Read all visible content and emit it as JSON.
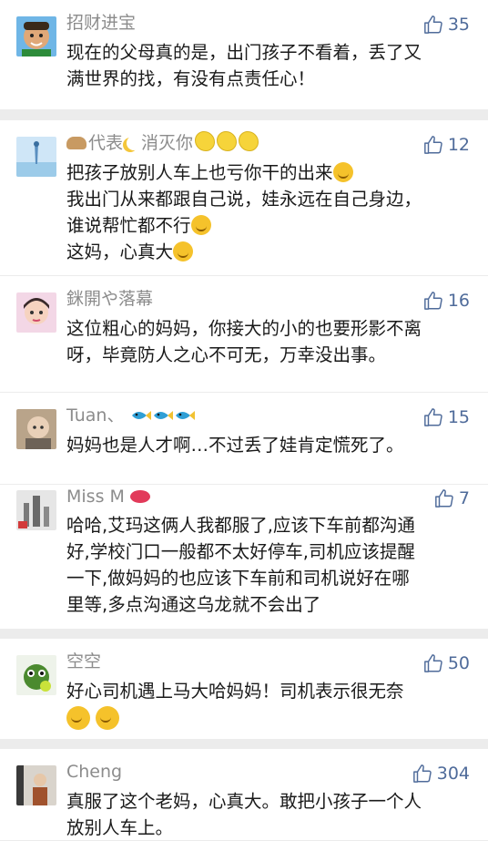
{
  "comments": [
    {
      "name": "招财进宝",
      "likes": "35",
      "lines": [
        "现在的父母真的是，出门孩子不看着，丢了又",
        "满世界的找，有没有点责任心！"
      ]
    },
    {
      "name_prefix": "代表",
      "name_suffix": "消灭你",
      "likes": "12",
      "lines": [
        "把孩子放别人车上也亏你干的出来",
        "我出门从来都跟自己说，娃永远在自己身边，",
        "谁说帮忙都不行",
        "这妈，心真大"
      ]
    },
    {
      "name": "銤開や落幕",
      "likes": "16",
      "lines": [
        "这位粗心的妈妈，你接大的小的也要形影不离",
        "呀，毕竟防人之心不可无，万幸没出事。"
      ]
    },
    {
      "name": "Tuan、",
      "likes": "15",
      "lines": [
        "妈妈也是人才啊…不过丢了娃肯定慌死了。"
      ]
    },
    {
      "name": "Miss M",
      "likes": "7",
      "lines": [
        "哈哈,艾玛这俩人我都服了,应该下车前都沟通",
        "好,学校门口一般都不太好停车,司机应该提醒",
        "一下,做妈妈的也应该下车前和司机说好在哪",
        "里等,多点沟通这乌龙就不会出了"
      ]
    },
    {
      "name": "空空",
      "likes": "50",
      "lines": [
        "好心司机遇上马大哈妈妈！司机表示很无奈"
      ]
    },
    {
      "name": "Cheng",
      "likes": "304",
      "lines": [
        "真服了这个老妈，心真大。敢把小孩子一个人",
        "放别人车上。"
      ]
    }
  ],
  "colors": {
    "name": "#8c8c8c",
    "like": "#4f6b9a",
    "text": "#1a1a1a",
    "separator": "#ececec"
  }
}
